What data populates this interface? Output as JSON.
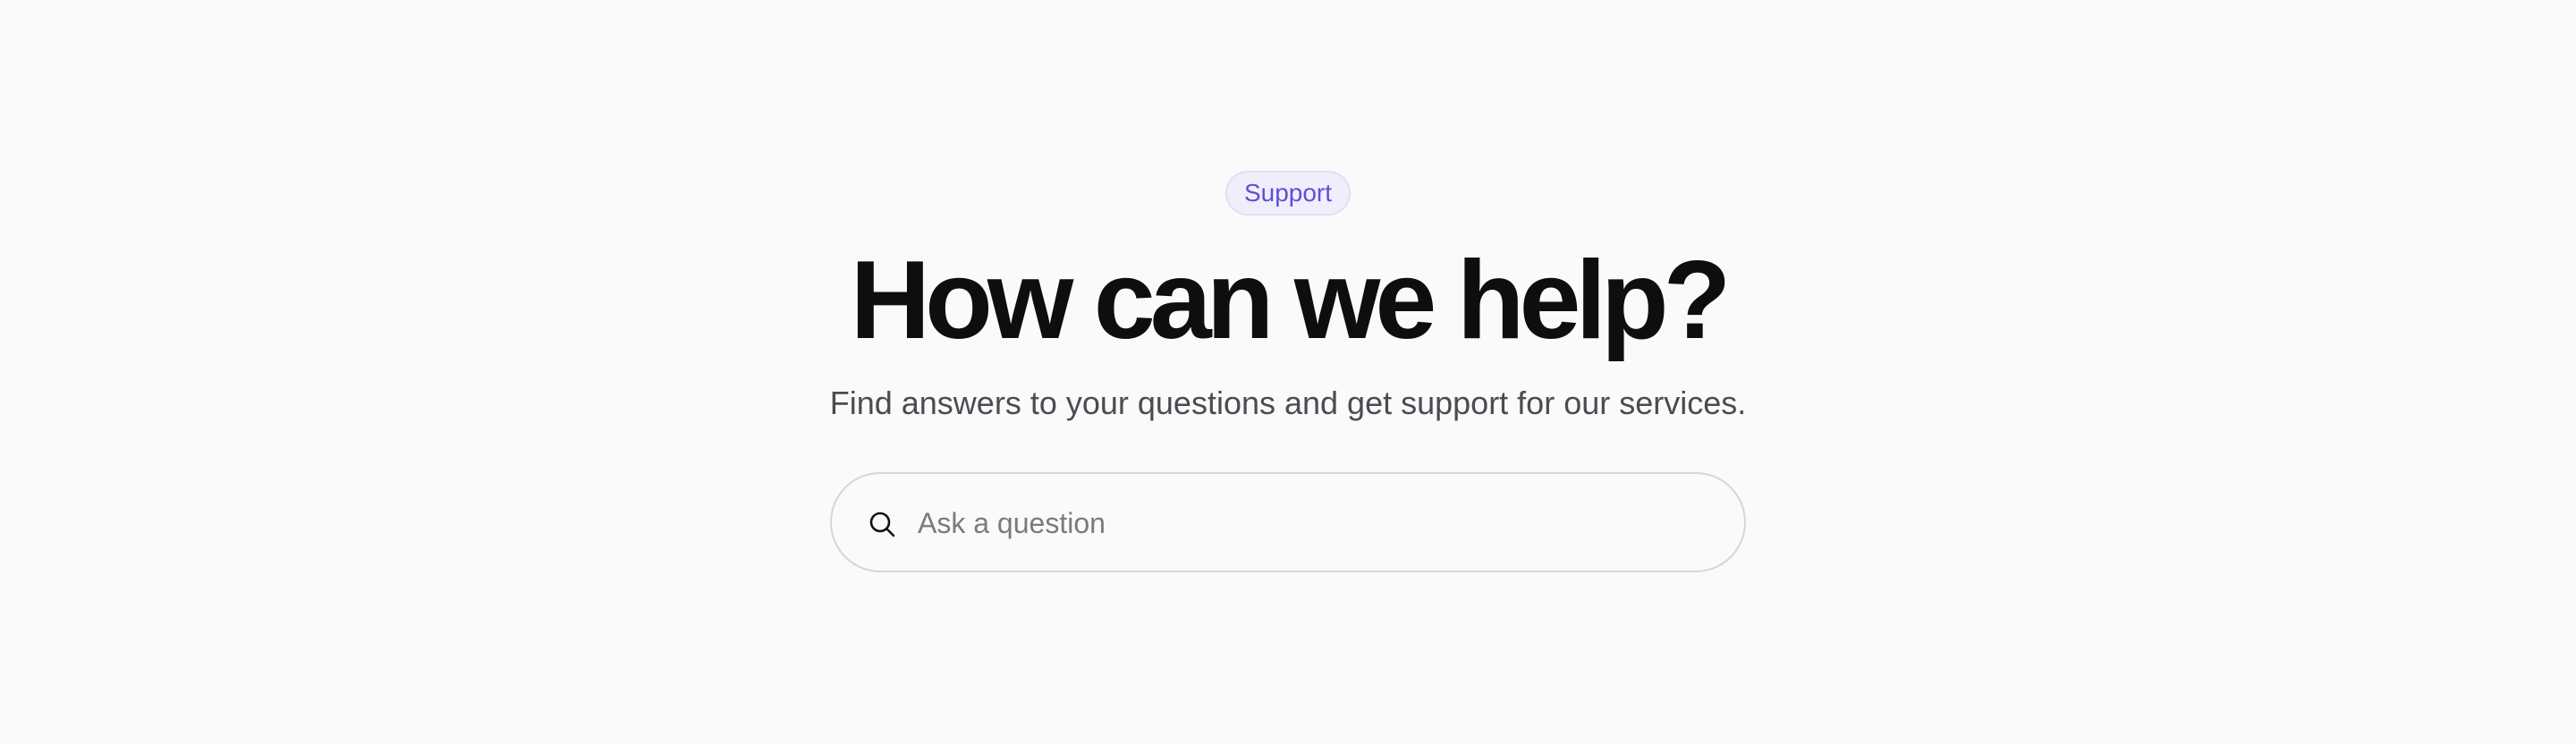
{
  "hero": {
    "badge_label": "Support",
    "title": "How can we help?",
    "subtitle": "Find answers to your questions and get support for our services."
  },
  "search": {
    "icon": "search-icon",
    "placeholder": "Ask a question",
    "value": ""
  },
  "colors": {
    "background": "#fafafa",
    "badge_background": "#f0eefc",
    "badge_text": "#5d4fd6",
    "title_text": "#0e0e10",
    "subtitle_text": "#4b4b52",
    "search_border": "#d6d6d9"
  }
}
